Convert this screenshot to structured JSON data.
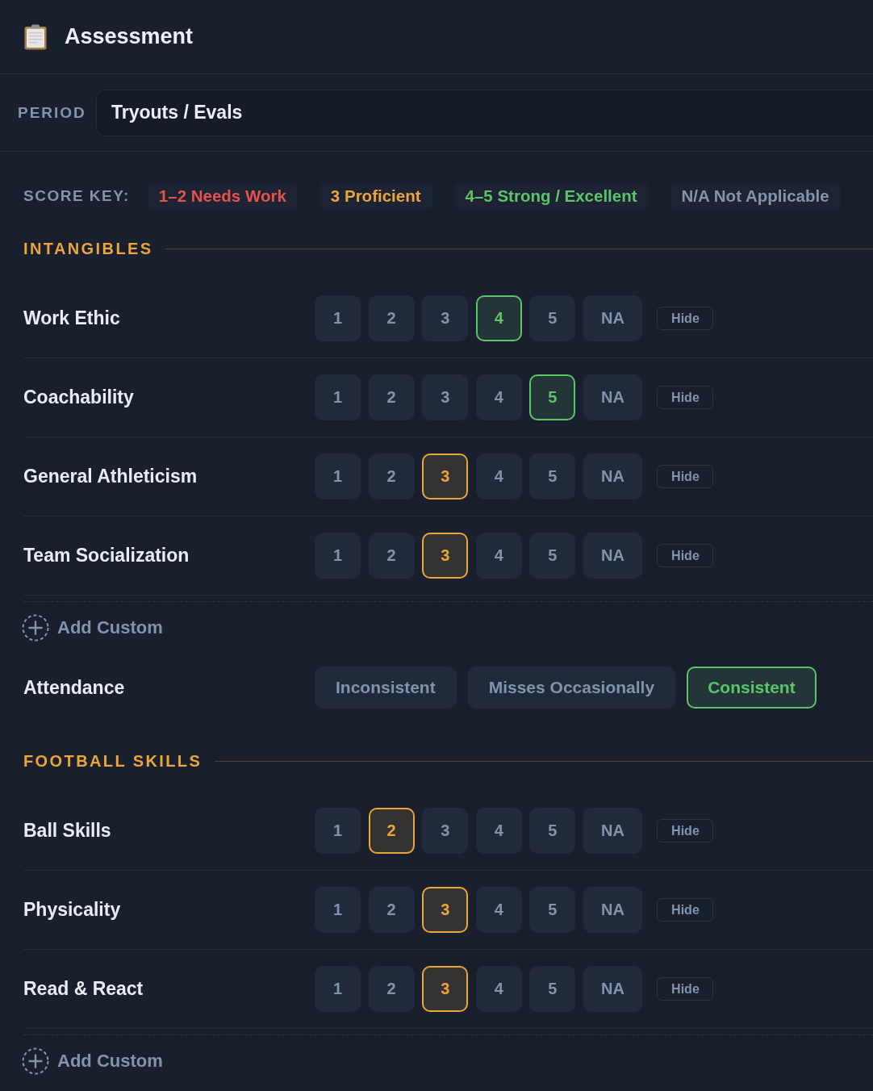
{
  "header": {
    "title": "Assessment"
  },
  "period": {
    "label": "PERIOD",
    "value": "Tryouts / Evals"
  },
  "score_key": {
    "label": "SCORE KEY:",
    "items": [
      {
        "text": "1–2 Needs Work",
        "color": "#e5534b"
      },
      {
        "text": "3 Proficient",
        "color": "#eba53a"
      },
      {
        "text": "4–5 Strong / Excellent",
        "color": "#5cc46a"
      },
      {
        "text": "N/A Not Applicable",
        "color": "#8494ac"
      }
    ]
  },
  "sections": [
    {
      "title": "INTANGIBLES",
      "items": [
        {
          "kind": "scale",
          "label": "Work Ethic",
          "hide": "Hide",
          "options": [
            {
              "text": "1",
              "selected": false
            },
            {
              "text": "2",
              "selected": false
            },
            {
              "text": "3",
              "selected": false
            },
            {
              "text": "4",
              "selected": true,
              "color": "#5cc46a"
            },
            {
              "text": "5",
              "selected": false
            },
            {
              "text": "NA",
              "selected": false
            }
          ]
        },
        {
          "kind": "scale",
          "label": "Coachability",
          "hide": "Hide",
          "options": [
            {
              "text": "1",
              "selected": false
            },
            {
              "text": "2",
              "selected": false
            },
            {
              "text": "3",
              "selected": false
            },
            {
              "text": "4",
              "selected": false
            },
            {
              "text": "5",
              "selected": true,
              "color": "#5cc46a"
            },
            {
              "text": "NA",
              "selected": false
            }
          ]
        },
        {
          "kind": "scale",
          "label": "General Athleticism",
          "hide": "Hide",
          "options": [
            {
              "text": "1",
              "selected": false
            },
            {
              "text": "2",
              "selected": false
            },
            {
              "text": "3",
              "selected": true,
              "color": "#eba53a"
            },
            {
              "text": "4",
              "selected": false
            },
            {
              "text": "5",
              "selected": false
            },
            {
              "text": "NA",
              "selected": false
            }
          ]
        },
        {
          "kind": "scale",
          "label": "Team Socialization",
          "hide": "Hide",
          "options": [
            {
              "text": "1",
              "selected": false
            },
            {
              "text": "2",
              "selected": false
            },
            {
              "text": "3",
              "selected": true,
              "color": "#eba53a"
            },
            {
              "text": "4",
              "selected": false
            },
            {
              "text": "5",
              "selected": false
            },
            {
              "text": "NA",
              "selected": false
            }
          ]
        },
        {
          "kind": "add",
          "label": "Add Custom"
        },
        {
          "kind": "choice",
          "label": "Attendance",
          "options": [
            {
              "text": "Inconsistent",
              "selected": false
            },
            {
              "text": "Misses Occasionally",
              "selected": false
            },
            {
              "text": "Consistent",
              "selected": true,
              "color": "#5cc46a"
            }
          ]
        }
      ]
    },
    {
      "title": "FOOTBALL SKILLS",
      "items": [
        {
          "kind": "scale",
          "label": "Ball Skills",
          "hide": "Hide",
          "options": [
            {
              "text": "1",
              "selected": false
            },
            {
              "text": "2",
              "selected": true,
              "color": "#eba53a"
            },
            {
              "text": "3",
              "selected": false
            },
            {
              "text": "4",
              "selected": false
            },
            {
              "text": "5",
              "selected": false
            },
            {
              "text": "NA",
              "selected": false
            }
          ]
        },
        {
          "kind": "scale",
          "label": "Physicality",
          "hide": "Hide",
          "options": [
            {
              "text": "1",
              "selected": false
            },
            {
              "text": "2",
              "selected": false
            },
            {
              "text": "3",
              "selected": true,
              "color": "#eba53a"
            },
            {
              "text": "4",
              "selected": false
            },
            {
              "text": "5",
              "selected": false
            },
            {
              "text": "NA",
              "selected": false
            }
          ]
        },
        {
          "kind": "scale",
          "label": "Read & React",
          "hide": "Hide",
          "options": [
            {
              "text": "1",
              "selected": false
            },
            {
              "text": "2",
              "selected": false
            },
            {
              "text": "3",
              "selected": true,
              "color": "#eba53a"
            },
            {
              "text": "4",
              "selected": false
            },
            {
              "text": "5",
              "selected": false
            },
            {
              "text": "NA",
              "selected": false
            }
          ]
        },
        {
          "kind": "add",
          "label": "Add Custom"
        }
      ]
    }
  ]
}
